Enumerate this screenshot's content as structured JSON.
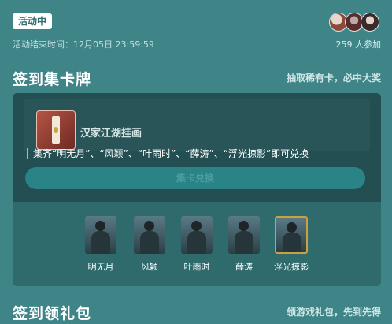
{
  "status_badge": "活动中",
  "end_time": "活动结束时间：12月05日 23:59:59",
  "participants": "259 人参加",
  "section1": {
    "title": "签到集卡牌",
    "subtitle": "抽取稀有卡，必中大奖",
    "reward": {
      "name": "汉家江湖挂画",
      "collect_note": "集齐“明无月”、“风颖”、“叶雨时”、“薛涛”、“浮光掠影”即可兑换",
      "button_label": "集卡兑换"
    },
    "cards": [
      {
        "label": "明无月"
      },
      {
        "label": "风颖"
      },
      {
        "label": "叶雨时"
      },
      {
        "label": "薛涛"
      },
      {
        "label": "浮光掠影"
      }
    ]
  },
  "section2": {
    "title": "签到领礼包",
    "subtitle": "领游戏礼包，先到先得"
  },
  "colors": {
    "background": "#3f8588",
    "panel": "#2f6a6c",
    "accent": "#e9b23a",
    "button": "#2a8487"
  }
}
